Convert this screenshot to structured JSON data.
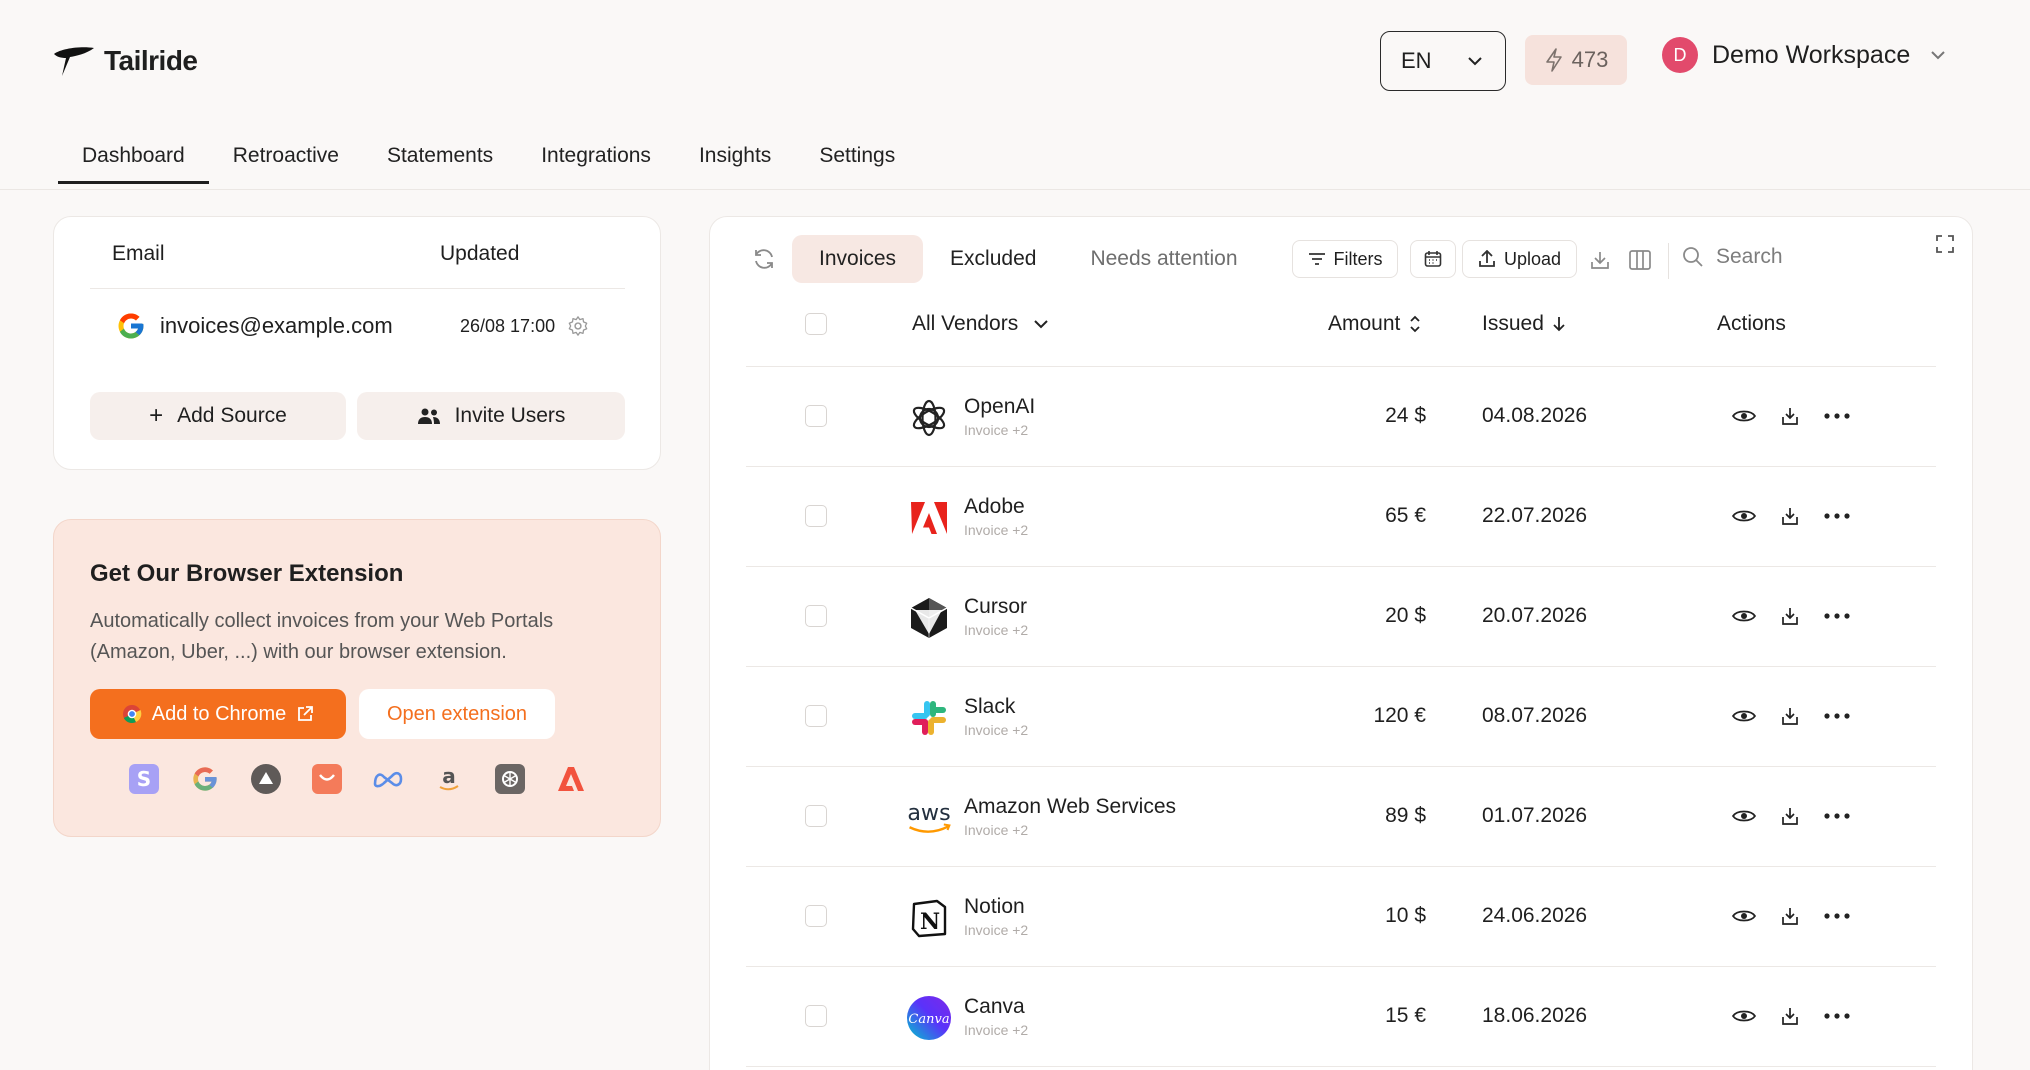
{
  "brand": {
    "name": "Tailride"
  },
  "header": {
    "language": "EN",
    "credits": "473",
    "workspace_initial": "D",
    "workspace_name": "Demo Workspace"
  },
  "nav": {
    "tabs": [
      {
        "label": "Dashboard",
        "active": true
      },
      {
        "label": "Retroactive"
      },
      {
        "label": "Statements"
      },
      {
        "label": "Integrations"
      },
      {
        "label": "Insights"
      },
      {
        "label": "Settings"
      }
    ]
  },
  "sources": {
    "col_email": "Email",
    "col_updated": "Updated",
    "email": "invoices@example.com",
    "updated": "26/08 17:00",
    "add_source": "Add Source",
    "invite_users": "Invite Users"
  },
  "extension": {
    "title": "Get Our Browser Extension",
    "desc_line1": "Automatically collect invoices from your Web Portals",
    "desc_line2": "(Amazon, Uber, ...) with our browser extension.",
    "add_chrome": "Add to Chrome",
    "open_ext": "Open extension",
    "icons": [
      "stripe-icon",
      "google-icon",
      "vercel-icon",
      "shopify-icon",
      "meta-icon",
      "amazon-icon",
      "openai-icon",
      "adobe-icon"
    ]
  },
  "invoices": {
    "tabs": [
      "Invoices",
      "Excluded",
      "Needs attention"
    ],
    "filters": "Filters",
    "upload": "Upload",
    "search_placeholder": "Search",
    "col_vendors": "All Vendors",
    "col_amount": "Amount",
    "col_issued": "Issued",
    "col_actions": "Actions",
    "rows": [
      {
        "vendor": "OpenAI",
        "sub": "Invoice +2",
        "amount": "24 $",
        "issued": "04.08.2026",
        "logo": "openai"
      },
      {
        "vendor": "Adobe",
        "sub": "Invoice +2",
        "amount": "65 €",
        "issued": "22.07.2026",
        "logo": "adobe"
      },
      {
        "vendor": "Cursor",
        "sub": "Invoice +2",
        "amount": "20 $",
        "issued": "20.07.2026",
        "logo": "cursor"
      },
      {
        "vendor": "Slack",
        "sub": "Invoice +2",
        "amount": "120 €",
        "issued": "08.07.2026",
        "logo": "slack"
      },
      {
        "vendor": "Amazon Web Services",
        "sub": "Invoice +2",
        "amount": "89 $",
        "issued": "01.07.2026",
        "logo": "aws"
      },
      {
        "vendor": "Notion",
        "sub": "Invoice +2",
        "amount": "10 $",
        "issued": "24.06.2026",
        "logo": "notion"
      },
      {
        "vendor": "Canva",
        "sub": "Invoice +2",
        "amount": "15 €",
        "issued": "18.06.2026",
        "logo": "canva"
      }
    ]
  },
  "colors": {
    "accent": "#f46f1e",
    "avatar": "#e24a6c",
    "active_tab_bg": "#f7e8e3"
  }
}
